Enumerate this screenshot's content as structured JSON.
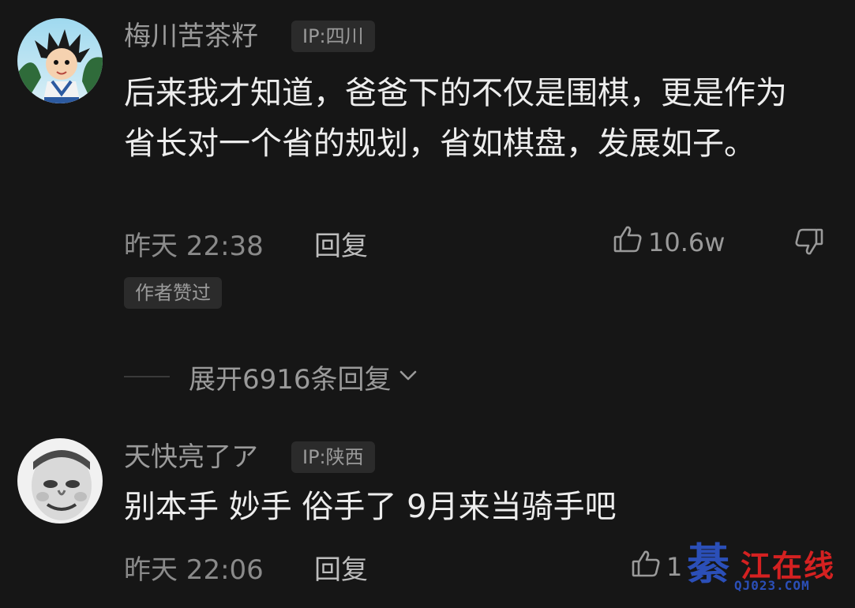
{
  "comments": [
    {
      "username": "梅川苦茶籽",
      "ip": "IP:四川",
      "text": "后来我才知道，爸爸下的不仅是围棋，更是作为省长对一个省的规划，省如棋盘，发展如子。",
      "time": "昨天 22:38",
      "reply_label": "回复",
      "like_count": "10.6w",
      "author_badge": "作者赞过",
      "expand_label": "展开6916条回复"
    },
    {
      "username": "天快亮了ア",
      "ip": "IP:陕西",
      "text": "别本手 妙手 俗手了  9月来当骑手吧",
      "time": "昨天 22:06",
      "reply_label": "回复",
      "like_count": "1"
    }
  ],
  "watermark": {
    "glyph": "綦",
    "name": "江在线",
    "url": "QJ023.COM"
  },
  "icons": {
    "like": "thumbs-up-icon",
    "dislike": "thumbs-down-icon",
    "expand": "chevron-down-icon"
  },
  "colors": {
    "background": "#161616",
    "text_primary": "#ededed",
    "text_secondary": "#9a9a9a",
    "badge_bg": "#2b2b2b"
  }
}
